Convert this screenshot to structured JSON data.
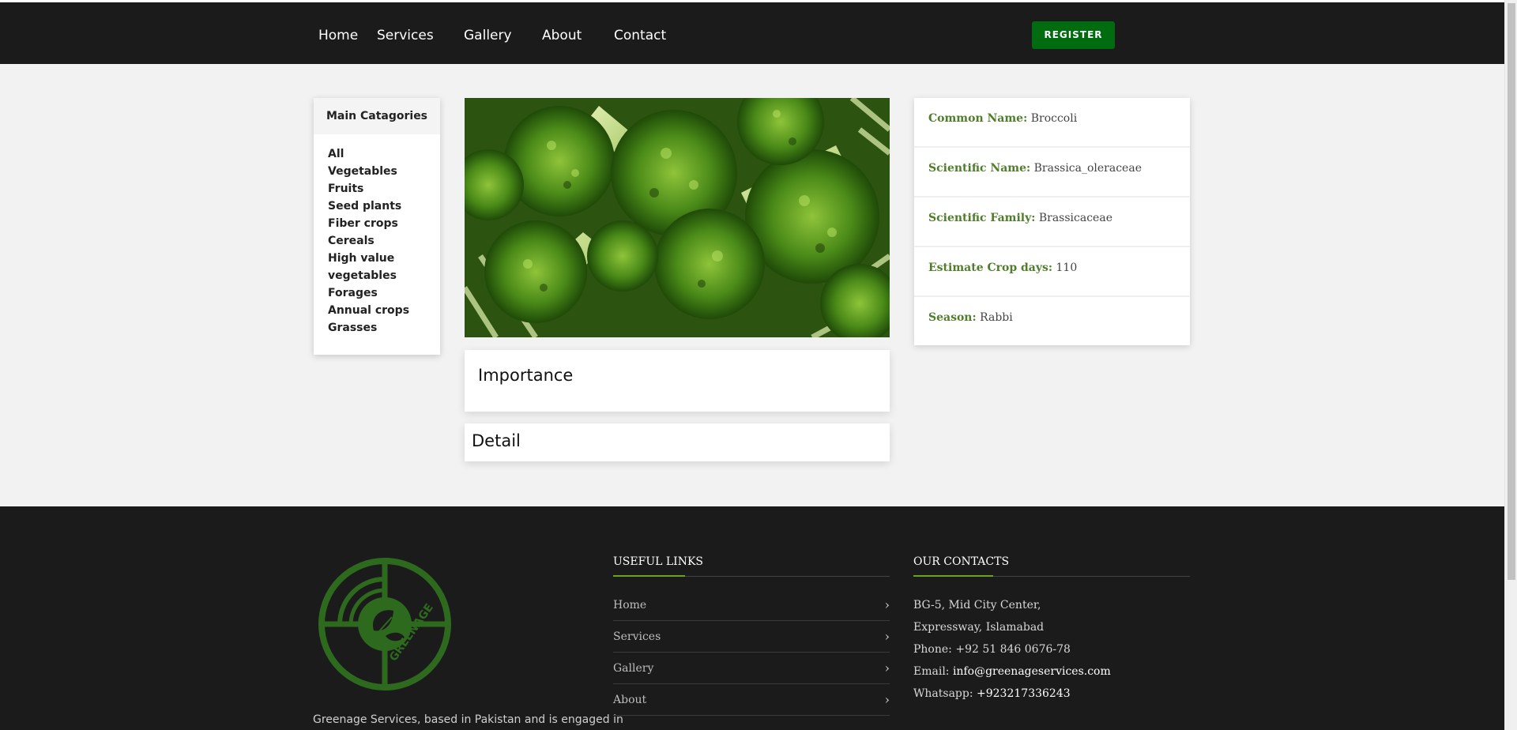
{
  "colors": {
    "nav_bg": "#1b1b1b",
    "register_bg": "#006b0f",
    "label_green": "#4f7d2b",
    "footer_bg": "#1b1b1b",
    "accent": "#67a51a",
    "logo_green": "#2d6a1e"
  },
  "nav": {
    "items": [
      "Home",
      "Services",
      "Gallery",
      "About",
      "Contact"
    ],
    "register_label": "REGISTER"
  },
  "categories": {
    "title": "Main Catagories",
    "items": [
      "All",
      "Vegetables",
      "Fruits",
      "Seed plants",
      "Fiber crops",
      "Cereals",
      "High value",
      "vegetables",
      "Forages",
      "Annual crops",
      "Grasses"
    ]
  },
  "hero": {
    "icon": "broccoli-photo"
  },
  "sections": {
    "importance": "Importance",
    "detail": "Detail"
  },
  "crop_info": [
    {
      "label": "Common Name:",
      "value": "Broccoli"
    },
    {
      "label": "Scientific Name:",
      "value": "Brassica_oleraceae"
    },
    {
      "label": "Scientific Family:",
      "value": "Brassicaceae"
    },
    {
      "label": "Estimate Crop days:",
      "value": "110"
    },
    {
      "label": "Season:",
      "value": "Rabbi"
    }
  ],
  "footer": {
    "logo_text": "GREENAGE",
    "description": "Greenage Services, based in Pakistan and is engaged in",
    "useful_links_title": "USEFUL LINKS",
    "useful_links": [
      "Home",
      "Services",
      "Gallery",
      "About"
    ],
    "contacts_title": "OUR CONTACTS",
    "address_line1": "BG-5, Mid City Center,",
    "address_line2": "Expressway, Islamabad",
    "phone": "Phone: +92 51 846 0676-78",
    "email_label": "Email:",
    "email": "info@greenageservices.com",
    "whatsapp_label": "Whatsapp:",
    "whatsapp": "+923217336243"
  }
}
